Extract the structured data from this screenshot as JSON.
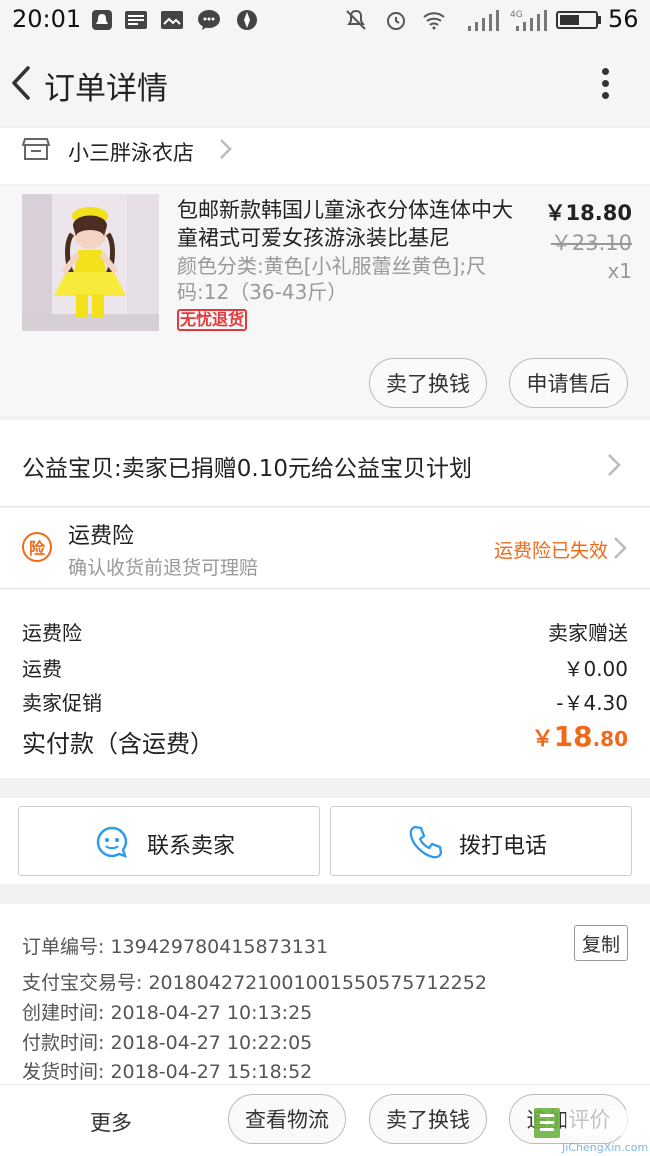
{
  "status_bar": {
    "time": "20:01",
    "battery": "56",
    "battery_fraction": 0.56,
    "left_icons": [
      "qq-icon",
      "news-icon",
      "message-icon",
      "wechat-icon",
      "app-icon"
    ],
    "right_icons": [
      "mute-icon",
      "alarm-icon",
      "wifi-icon",
      "signal-icon",
      "signal-4g-icon",
      "battery-icon"
    ]
  },
  "header": {
    "title": "订单详情"
  },
  "shop": {
    "name": "小三胖泳衣店"
  },
  "product": {
    "title": "包邮新款韩国儿童泳衣分体连体中大童裙式可爱女孩游泳装比基尼",
    "sku": "颜色分类:黄色[小礼服蕾丝黄色];尺码:12（36-43斤）",
    "tag": "无忧退货",
    "price": "￥18.80",
    "original_price": "￥23.10",
    "quantity": "x1",
    "actions": {
      "sell_label": "卖了换钱",
      "after_sale_label": "申请售后"
    }
  },
  "charity": {
    "text": "公益宝贝:卖家已捐赠0.10元给公益宝贝计划"
  },
  "insurance": {
    "icon_char": "险",
    "title": "运费险",
    "subtitle": "确认收货前退货可理赔",
    "status": "运费险已失效"
  },
  "costs": {
    "rows": [
      {
        "label": "运费险",
        "value": "卖家赠送"
      },
      {
        "label": "运费",
        "value": "￥0.00"
      },
      {
        "label": "卖家促销",
        "value": "-￥4.30"
      }
    ],
    "total_label": "实付款（含运费）",
    "total_currency": "￥",
    "total_integer": "18",
    "total_decimal": ".80"
  },
  "contact": {
    "seller_label": "联系卖家",
    "call_label": "拨打电话"
  },
  "order_info": {
    "order_no_label": "订单编号:",
    "order_no": "139429780415873131",
    "copy_label": "复制",
    "lines": [
      {
        "label": "支付宝交易号:",
        "value": "2018042721001001550575712252"
      },
      {
        "label": "创建时间:",
        "value": "2018-04-27 10:13:25"
      },
      {
        "label": "付款时间:",
        "value": "2018-04-27 10:22:05"
      },
      {
        "label": "发货时间:",
        "value": "2018-04-27 15:18:52"
      }
    ]
  },
  "bottom_bar": {
    "more_label": "更多",
    "logistics_label": "查看物流",
    "sell_label": "卖了换钱",
    "review_label": "追加评价"
  },
  "watermark": {
    "text": "JiChengXin.com"
  },
  "colors": {
    "accent": "#f06a1a",
    "tag_red": "#e4393c",
    "contact_blue": "#2e9ae8"
  }
}
